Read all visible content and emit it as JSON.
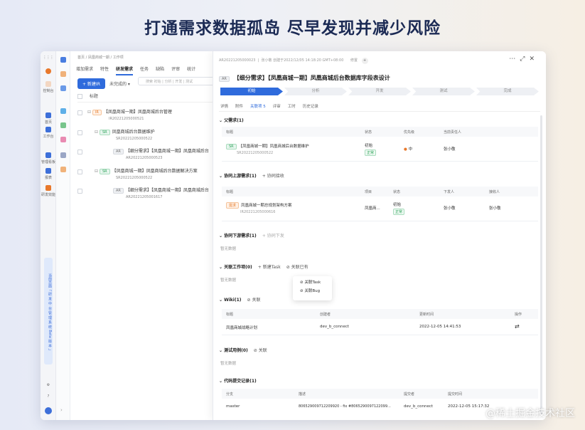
{
  "headline": "打通需求数据孤岛 尽早发现并减少风险",
  "watermark": "@稀土掘金技术社区",
  "rail": {
    "items": [
      {
        "label": "控制台",
        "icon": "dashboard-icon",
        "color": "#e8782b"
      },
      {
        "label": "首页",
        "icon": "home-icon",
        "color": "#3d6fd9"
      },
      {
        "label": "工作台",
        "icon": "workbench-icon",
        "color": "#3d6fd9"
      },
      {
        "label": "管理看板",
        "icon": "board-icon",
        "color": "#3d6fd9"
      },
      {
        "label": "报表",
        "icon": "report-icon",
        "color": "#3d6fd9"
      },
      {
        "label": "研发效能",
        "icon": "efficiency-icon",
        "color": "#e8782b"
      }
    ],
    "vertical_text": "当前页面「 研 发 中 台 管 理 系 统 Beta 版 本 」"
  },
  "list": {
    "breadcrumb": "首页 / 凤凰商城一期 / 工作项",
    "tabs": [
      "增加需求",
      "特性",
      "研发需求",
      "任务",
      "缺陷",
      "评审",
      "统计"
    ],
    "active_tab": "研发需求",
    "new_button": "+ 新建IR",
    "filter": "未完成的 ▾",
    "search_placeholder": "搜索 初始 | 分析 | 开发 | 测试",
    "column_title": "标题",
    "rows": [
      {
        "tag": "IR",
        "title": "【凤凰商城一期】凤凰商城后台管理",
        "code": "IR20221205000521"
      },
      {
        "tag": "SR",
        "title": "凤凰商城后台数据维护",
        "code": "SR20221205000522"
      },
      {
        "tag": "AR",
        "title": "【细分需求】【凤凰商城一期】凤凰商城后台",
        "code": "AR20221205000523"
      },
      {
        "tag": "SR",
        "title": "【凤凰商城一期】凤凰商城后台数据解决方案",
        "code": "SR20221205000522"
      },
      {
        "tag": "AR",
        "title": "【细分需求】【凤凰商城一期】凤凰商城后台",
        "code": "AR20221205001617"
      }
    ]
  },
  "detail": {
    "id_line": "AR20221205000023",
    "meta": "张小敬 创建于2022/12/05 14:18:20 GMT+08:00",
    "follow": "修置",
    "title_tag": "AR",
    "title": "【细分需求】【凤凰商城一期】凤凰商城后台数据库字段表设计",
    "steps": [
      "初始",
      "分析",
      "开发",
      "测试",
      "完成"
    ],
    "active_step": "初始",
    "tabs": [
      "详情",
      "附件",
      "关联项 5",
      "评审",
      "工时",
      "历史记录"
    ],
    "active_tab": "关联项 5",
    "parent": {
      "section": "父需求(1)",
      "headers": [
        "标题",
        "状态",
        "优先级",
        "当前责任人"
      ],
      "row": {
        "tag": "SR",
        "title": "【凤凰商城一期】凤凰商城后台数据维护",
        "code": "SR20221205000522",
        "status": "初始",
        "status_badge": "正常",
        "priority": "中",
        "owner": "张小敬"
      }
    },
    "upstream": {
      "section": "协同上游需求(1)",
      "action": "+ 协同接收",
      "headers": [
        "标题",
        "项目",
        "状态",
        "下发人",
        "接收人"
      ],
      "row": {
        "tag": "需求",
        "title": "凤凰商城一期总规划架构方案",
        "code": "IR20221205000616",
        "project": "凤凰商...",
        "status": "初始",
        "status_badge": "正常",
        "sender": "张小敬",
        "receiver": "张小敬"
      }
    },
    "downstream": {
      "section": "协同下游需求(1)",
      "action": "+ 协同下发",
      "empty": "暂无数据"
    },
    "workitems": {
      "section": "关联工作项(0)",
      "action1": "+ 新建Task",
      "action2": "关联已有",
      "empty": "暂无数据"
    },
    "popup": [
      "关联Task",
      "关联Bug"
    ],
    "wiki": {
      "section": "Wiki(1)",
      "action": "关联",
      "headers": [
        "标题",
        "创建者",
        "更新时间",
        "操作"
      ],
      "row": {
        "title": "凤凰商城战略计划",
        "creator": "dev_b_connect",
        "updated": "2022-12-05 14:41:53"
      }
    },
    "testcases": {
      "section": "测试用例(0)",
      "action": "关联",
      "empty": "暂无数据"
    },
    "commits": {
      "section": "代码提交记录(1)",
      "headers": [
        "分支",
        "描述",
        "提交者",
        "提交时间"
      ],
      "row": {
        "branch": "master",
        "desc": "806529009712209920 - fix #8065290097122099...",
        "committer": "dev_b_connect",
        "time": "2022-12-05 15:17:32"
      }
    }
  }
}
